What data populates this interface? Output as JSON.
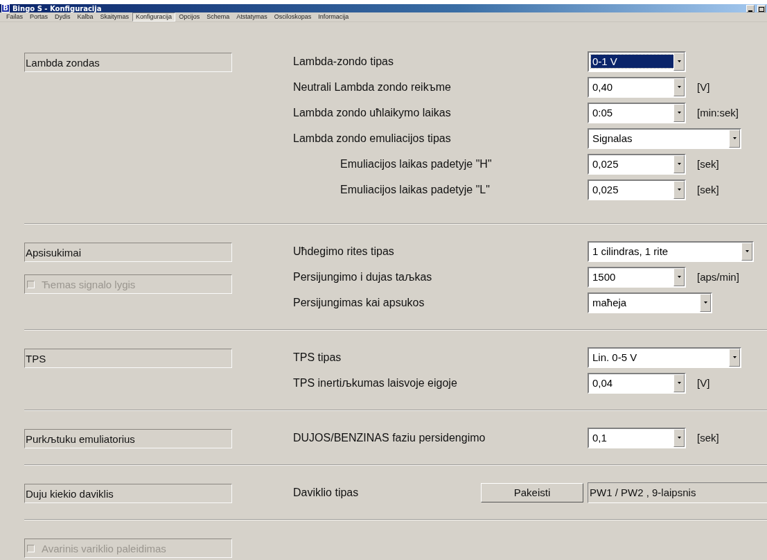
{
  "window": {
    "icon_letter": "B",
    "title": "Bingo S - Konfiguracija"
  },
  "menu": [
    {
      "label": "Failas",
      "selected": false
    },
    {
      "label": "Portas",
      "selected": false
    },
    {
      "label": "Dydis",
      "selected": false
    },
    {
      "label": "Kalba",
      "selected": false
    },
    {
      "label": "Skaitymas",
      "selected": false
    },
    {
      "label": "Konfiguracija",
      "selected": true
    },
    {
      "label": "Opcijos",
      "selected": false
    },
    {
      "label": "Schema",
      "selected": false
    },
    {
      "label": "Atstatymas",
      "selected": false
    },
    {
      "label": "Osciloskopas",
      "selected": false
    },
    {
      "label": "Informacija",
      "selected": false
    }
  ],
  "sections": [
    {
      "left": [
        {
          "kind": "group",
          "label": "Lambda zondas"
        }
      ],
      "rows": [
        {
          "label": "Lambda-zondo tipas",
          "control": {
            "kind": "combo",
            "value": "0-1 V",
            "focused": true
          }
        },
        {
          "label": "Neutrali Lambda zondo reikъme",
          "control": {
            "kind": "combo",
            "value": "0,40",
            "focused": false
          },
          "unit": "[V]"
        },
        {
          "label": "Lambda zondo uћlaikymo laikas",
          "control": {
            "kind": "combo",
            "value": "0:05",
            "focused": false
          },
          "unit": "[min:sek]"
        },
        {
          "label": "Lambda zondo emuliacijos tipas",
          "control": {
            "kind": "combo-wide",
            "value": "Signalas",
            "focused": false
          },
          "children": [
            {
              "label": "Emuliacijos laikas padetyje \"H\"",
              "control": {
                "kind": "combo",
                "value": "0,025",
                "focused": false
              },
              "unit": "[sek]"
            },
            {
              "label": "Emuliacijos laikas padetyje \"L\"",
              "control": {
                "kind": "combo",
                "value": "0,025",
                "focused": false
              },
              "unit": "[sek]"
            }
          ]
        }
      ]
    },
    {
      "left": [
        {
          "kind": "group",
          "label": "Apsisukimai"
        },
        {
          "kind": "checkbox",
          "label": "Ћemas signalo lygis",
          "checked": false,
          "disabled": true
        }
      ],
      "rows": [
        {
          "label": "Uћdegimo rites tipas",
          "control": {
            "kind": "combo-full",
            "value": "1 cilindras, 1 rite",
            "focused": false
          }
        },
        {
          "label": "Persijungimo i dujas taљkas",
          "control": {
            "kind": "combo",
            "value": "1500",
            "focused": false
          },
          "unit": "[aps/min]"
        },
        {
          "label": "Persijungimas kai apsukos",
          "control": {
            "kind": "combo-medium",
            "value": "maћeja",
            "focused": false
          }
        }
      ]
    },
    {
      "left": [
        {
          "kind": "group",
          "label": "TPS"
        }
      ],
      "rows": [
        {
          "label": "TPS tipas",
          "control": {
            "kind": "combo-wide",
            "value": "Lin. 0-5 V",
            "focused": false
          }
        },
        {
          "label": "TPS inertiљkumas laisvoje eigoje",
          "control": {
            "kind": "combo",
            "value": "0,04",
            "focused": false
          },
          "unit": "[V]"
        }
      ]
    },
    {
      "left": [
        {
          "kind": "group",
          "label": "Purkљtuku emuliatorius"
        }
      ],
      "rows": [
        {
          "label": "DUJOS/BENZINAS faziu persidengimo",
          "control": {
            "kind": "combo",
            "value": "0,1",
            "focused": false
          },
          "unit": "[sek]"
        }
      ]
    },
    {
      "left": [
        {
          "kind": "group",
          "label": "Duju kiekio daviklis"
        }
      ],
      "rows": [
        {
          "label": "Daviklio tipas",
          "button": "Pakeisti",
          "control": {
            "kind": "display",
            "value": "PW1 / PW2 , 9-laipsnis"
          }
        }
      ]
    },
    {
      "left": [
        {
          "kind": "checkbox",
          "label": "Avarinis variklio paleidimas",
          "checked": false,
          "disabled": true
        }
      ]
    }
  ]
}
